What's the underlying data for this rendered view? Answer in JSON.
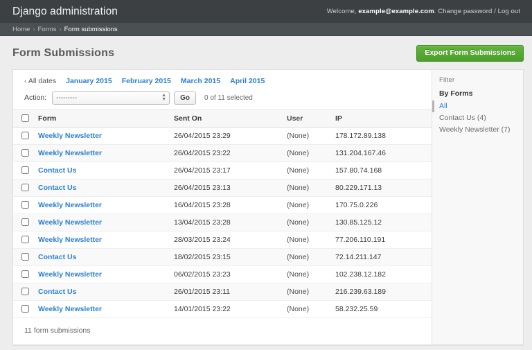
{
  "header": {
    "site_name": "Django administration",
    "welcome_prefix": "Welcome,",
    "username": "example@example.com",
    "punct_after_user": ".",
    "change_password": "Change password",
    "separator": "/",
    "logout": "Log out"
  },
  "breadcrumbs": {
    "home": "Home",
    "sep1": "›",
    "forms": "Forms",
    "sep2": "›",
    "current": "Form submissions"
  },
  "page": {
    "title": "Form Submissions",
    "export_button": "Export Form Submissions"
  },
  "date_hierarchy": {
    "back_chevron": "‹",
    "all_dates": "All dates",
    "links": [
      "January 2015",
      "February 2015",
      "March 2015",
      "April 2015"
    ]
  },
  "actions": {
    "label": "Action:",
    "selected_option": "---------",
    "options": [
      "---------"
    ],
    "go_label": "Go",
    "selection_count": "0 of 11 selected"
  },
  "table": {
    "columns": [
      "Form",
      "Sent On",
      "User",
      "IP"
    ],
    "rows": [
      {
        "form": "Weekly Newsletter",
        "sent_on": "26/04/2015 23:29",
        "user": "(None)",
        "ip": "178.172.89.138"
      },
      {
        "form": "Weekly Newsletter",
        "sent_on": "26/04/2015 23:22",
        "user": "(None)",
        "ip": "131.204.167.46"
      },
      {
        "form": "Contact Us",
        "sent_on": "26/04/2015 23:17",
        "user": "(None)",
        "ip": "157.80.74.168"
      },
      {
        "form": "Contact Us",
        "sent_on": "26/04/2015 23:13",
        "user": "(None)",
        "ip": "80.229.171.13"
      },
      {
        "form": "Weekly Newsletter",
        "sent_on": "16/04/2015 23:28",
        "user": "(None)",
        "ip": "170.75.0.226"
      },
      {
        "form": "Weekly Newsletter",
        "sent_on": "13/04/2015 23:28",
        "user": "(None)",
        "ip": "130.85.125.12"
      },
      {
        "form": "Weekly Newsletter",
        "sent_on": "28/03/2015 23:24",
        "user": "(None)",
        "ip": "77.206.110.191"
      },
      {
        "form": "Contact Us",
        "sent_on": "18/02/2015 23:15",
        "user": "(None)",
        "ip": "72.14.211.147"
      },
      {
        "form": "Weekly Newsletter",
        "sent_on": "06/02/2015 23:23",
        "user": "(None)",
        "ip": "102.238.12.182"
      },
      {
        "form": "Contact Us",
        "sent_on": "26/01/2015 23:11",
        "user": "(None)",
        "ip": "216.239.63.189"
      },
      {
        "form": "Weekly Newsletter",
        "sent_on": "14/01/2015 23:22",
        "user": "(None)",
        "ip": "58.232.25.59"
      }
    ],
    "result_count": "11 form submissions"
  },
  "filter": {
    "title": "Filter",
    "group_label": "By Forms",
    "items": [
      {
        "label": "All",
        "selected": true
      },
      {
        "label": "Contact Us (4)",
        "selected": false
      },
      {
        "label": "Weekly Newsletter (7)",
        "selected": false
      }
    ]
  },
  "colors": {
    "header_bg": "#3c4042",
    "breadcrumb_bg": "#4b5053",
    "page_bg": "#ededed",
    "link_blue": "#2b7fd1",
    "export_green": "#4ba02a"
  }
}
